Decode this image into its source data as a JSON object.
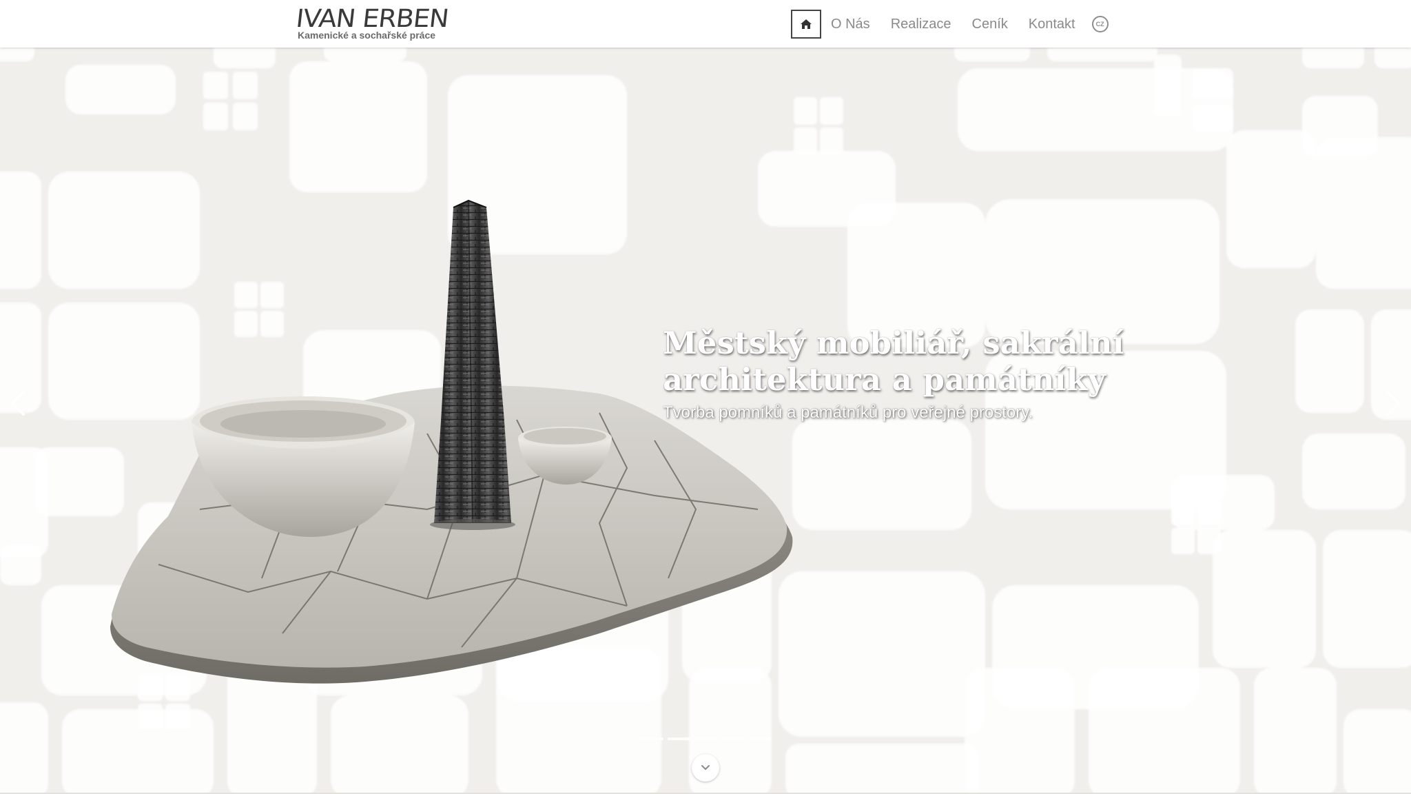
{
  "header": {
    "logo_title": "IVAN ERBEN",
    "logo_subtitle": "Kamenické a sochařské práce",
    "nav": {
      "home_icon": "home-icon",
      "items": [
        {
          "label": "O Nás"
        },
        {
          "label": "Realizace"
        },
        {
          "label": "Ceník"
        },
        {
          "label": "Kontakt"
        }
      ],
      "language": "CZ"
    }
  },
  "hero": {
    "title": "Městský mobiliář, sakrální architektura a památníky",
    "subtitle": "Tvorba pomníků a památníků pro veřejné prostory.",
    "prev_icon": "chevron-left-icon",
    "next_icon": "chevron-right-icon",
    "scroll_icon": "chevron-down-icon",
    "slide_count": 5
  },
  "colors": {
    "background": "#f1efec",
    "pattern": "#ffffff",
    "nav_text": "#8a8a8a",
    "logo_text": "#3a3a3a"
  }
}
